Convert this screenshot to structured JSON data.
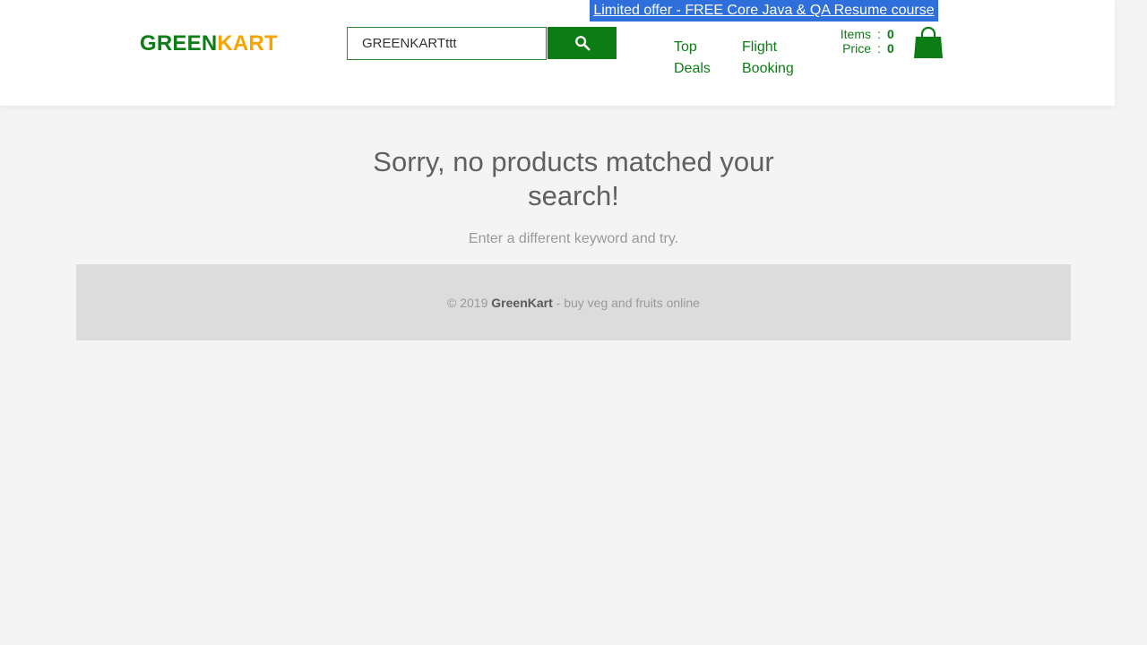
{
  "promo": {
    "text": "Limited offer - FREE Core Java & QA Resume course"
  },
  "brand": {
    "part1": "GREEN",
    "part2": "KART",
    "color_green": "#0c7d15",
    "color_orange": "#f7a400"
  },
  "search": {
    "value": "GREENKARTttt",
    "placeholder": "Search for Vegetables and Fruits",
    "button_icon": "search-icon"
  },
  "nav": {
    "top_deals": "Top Deals",
    "flight_booking": "Flight Booking"
  },
  "cart": {
    "items_label": "Items",
    "items_value": "0",
    "price_label": "Price",
    "price_value": "0",
    "separator": ":",
    "icon": "shopping-bag-icon"
  },
  "results": {
    "title": "Sorry, no products matched your search!",
    "subtitle": "Enter a different keyword and try."
  },
  "footer": {
    "prefix": "© 2019 ",
    "brand": "GreenKart",
    "suffix": " - buy veg and fruits online"
  },
  "colors": {
    "accent": "#0c7d15",
    "promo_bg": "#2f6fdc",
    "page_bg": "#f4f4f4",
    "footer_bg": "#dcdcdc"
  }
}
